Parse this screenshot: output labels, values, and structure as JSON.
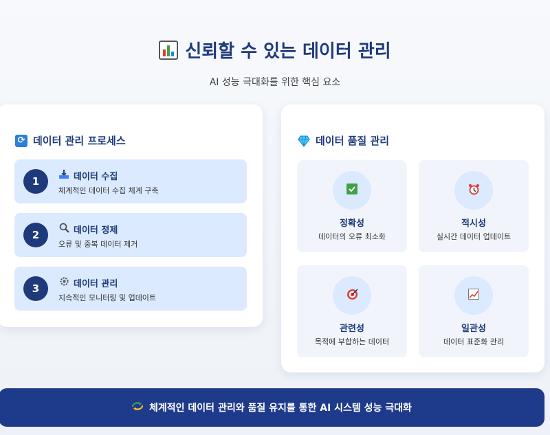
{
  "header": {
    "title": "신뢰할 수 있는 데이터 관리",
    "title_icon": "bar-chart-icon",
    "subtitle": "AI 성능 극대화를 위한 핵심 요소"
  },
  "process": {
    "title": "데이터 관리 프로세스",
    "title_icon": "refresh-icon",
    "steps": [
      {
        "num": "1",
        "icon": "inbox-tray-icon",
        "title": "데이터 수집",
        "desc": "체계적인 데이터 수집 체계 구축"
      },
      {
        "num": "2",
        "icon": "magnifier-icon",
        "title": "데이터 정제",
        "desc": "오류 및 중복 데이터 제거"
      },
      {
        "num": "3",
        "icon": "gear-icon",
        "title": "데이터 관리",
        "desc": "지속적인 모니터링 및 업데이트"
      }
    ]
  },
  "quality": {
    "title": "데이터 품질 관리",
    "title_icon": "gem-icon",
    "items": [
      {
        "icon": "check-mark-icon",
        "title": "정확성",
        "desc": "데이터의 오류 최소화"
      },
      {
        "icon": "alarm-clock-icon",
        "title": "적시성",
        "desc": "실시간 데이터 업데이트"
      },
      {
        "icon": "target-icon",
        "title": "관련성",
        "desc": "목적에 부합하는 데이터"
      },
      {
        "icon": "trend-chart-icon",
        "title": "일관성",
        "desc": "데이터 표준화 관리"
      }
    ]
  },
  "banner": {
    "icon": "recycle-arrows-icon",
    "text": "체계적인 데이터 관리와 품질 유지를 통한 AI 시스템 성능 극대화"
  },
  "colors": {
    "primary": "#1e3a7b",
    "banner": "#1e3a8a",
    "step_bg": "#dbeafe",
    "tile_bg": "#f1f5fb"
  }
}
